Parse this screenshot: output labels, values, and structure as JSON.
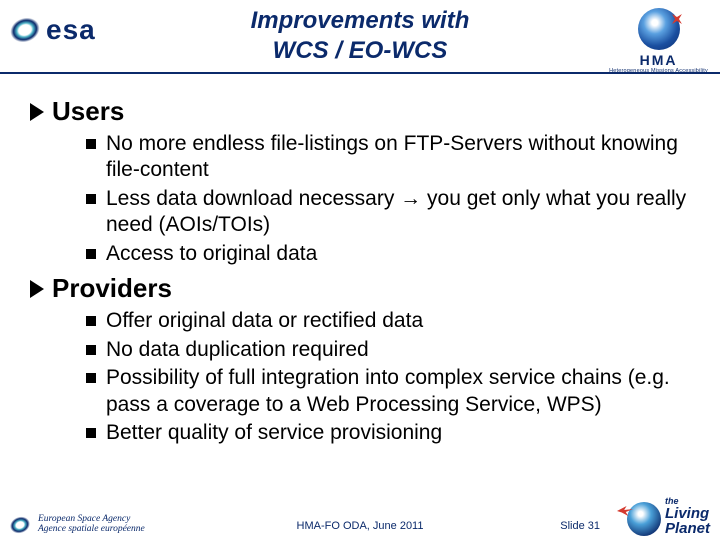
{
  "header": {
    "esa_text": "esa",
    "title_line1": "Improvements with",
    "title_line2": "WCS / EO-WCS",
    "hma_text": "HMA",
    "hma_sub": "Heterogeneous Missions Accessibility"
  },
  "sections": [
    {
      "title": "Users",
      "items": [
        "No more endless file-listings on FTP-Servers without knowing file-content",
        "Less data download necessary → you get only what you really need (AOIs/TOIs)",
        "Access to original data"
      ]
    },
    {
      "title": "Providers",
      "items": [
        "Offer original data or rectified data",
        "No data duplication required",
        "Possibility of full integration into complex service chains (e.g. pass a coverage to a Web Processing Service, WPS)",
        "Better quality of service provisioning"
      ]
    }
  ],
  "footer": {
    "left_line1": "European Space Agency",
    "left_line2": "Agence spatiale européenne",
    "center": "HMA-FO ODA, June 2011",
    "slide": "Slide 31",
    "lp_the": "the",
    "lp_living": "Living",
    "lp_planet": "Planet"
  }
}
